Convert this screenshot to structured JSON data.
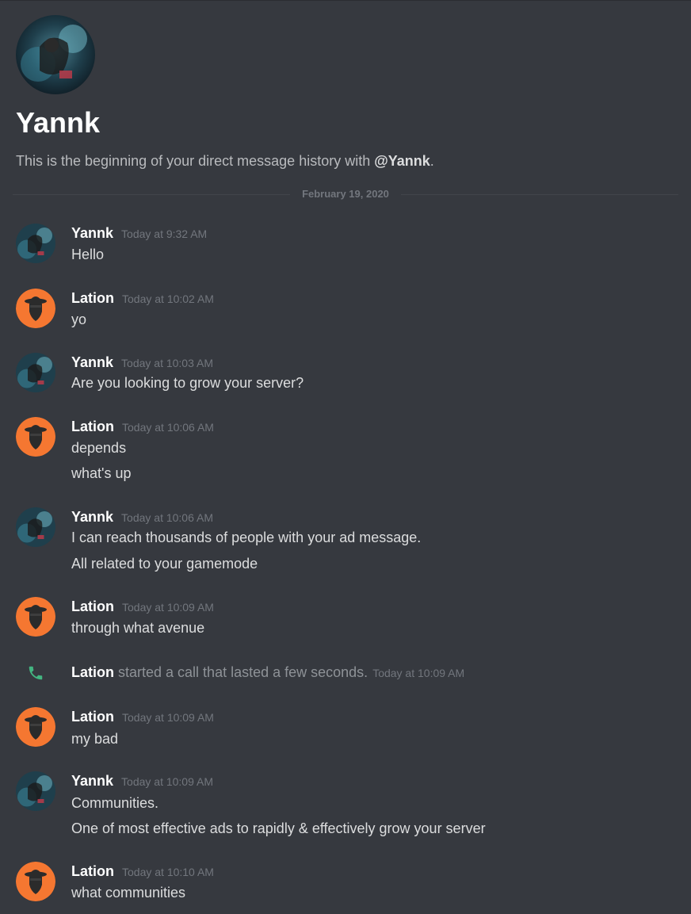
{
  "header": {
    "name": "Yannk",
    "intro_prefix": "This is the beginning of your direct message history with ",
    "intro_mention": "@Yannk",
    "intro_suffix": "."
  },
  "divider": {
    "date": "February 19, 2020"
  },
  "messages": [
    {
      "author": "Yannk",
      "time": "Today at 9:32 AM",
      "lines": [
        "Hello"
      ]
    },
    {
      "author": "Lation",
      "time": "Today at 10:02 AM",
      "lines": [
        "yo"
      ]
    },
    {
      "author": "Yannk",
      "time": "Today at 10:03 AM",
      "lines": [
        "Are you looking to grow your server?"
      ]
    },
    {
      "author": "Lation",
      "time": "Today at 10:06 AM",
      "lines": [
        "depends",
        "what's up"
      ]
    },
    {
      "author": "Yannk",
      "time": "Today at 10:06 AM",
      "lines": [
        "I can reach thousands of people with your ad message.",
        "All related to your gamemode"
      ]
    },
    {
      "author": "Lation",
      "time": "Today at 10:09 AM",
      "lines": [
        "through what avenue"
      ]
    },
    {
      "author": "Lation",
      "time": "Today at 10:09 AM",
      "lines": [
        "my bad"
      ]
    },
    {
      "author": "Yannk",
      "time": "Today at 10:09 AM",
      "lines": [
        "Communities.",
        "One of most effective ads to rapidly & effectively grow your server"
      ]
    },
    {
      "author": "Lation",
      "time": "Today at 10:10 AM",
      "lines": [
        "what communities"
      ]
    }
  ],
  "call": {
    "who": "Lation",
    "text": " started a call that lasted a few seconds.",
    "time": "Today at 10:09 AM"
  },
  "colors": {
    "background": "#36393f",
    "lation_avatar": "#f57731",
    "call_icon": "#43b581"
  },
  "icons": {
    "call": "phone-icon"
  }
}
